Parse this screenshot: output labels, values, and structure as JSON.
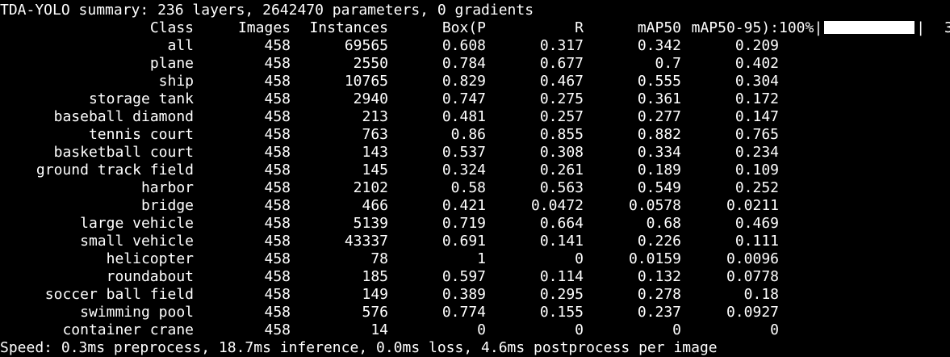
{
  "summary": "TDA-YOLO summary: 236 layers, 2642470 parameters, 0 gradients",
  "header": {
    "class": "Class",
    "images": "Images",
    "instances": "Instances",
    "p": "Box(P",
    "r": "R",
    "map50": "mAP50",
    "map50_95": "mAP50-95):",
    "progress": "100%",
    "progress_fraction": 1.0,
    "bar_left": "|",
    "bar_right": "|",
    "edge": "3"
  },
  "rows": [
    {
      "class": "all",
      "images": "458",
      "instances": "69565",
      "p": "0.608",
      "r": "0.317",
      "map50": "0.342",
      "map50_95": "0.209"
    },
    {
      "class": "plane",
      "images": "458",
      "instances": "2550",
      "p": "0.784",
      "r": "0.677",
      "map50": "0.7",
      "map50_95": "0.402"
    },
    {
      "class": "ship",
      "images": "458",
      "instances": "10765",
      "p": "0.829",
      "r": "0.467",
      "map50": "0.555",
      "map50_95": "0.304"
    },
    {
      "class": "storage tank",
      "images": "458",
      "instances": "2940",
      "p": "0.747",
      "r": "0.275",
      "map50": "0.361",
      "map50_95": "0.172"
    },
    {
      "class": "baseball diamond",
      "images": "458",
      "instances": "213",
      "p": "0.481",
      "r": "0.257",
      "map50": "0.277",
      "map50_95": "0.147"
    },
    {
      "class": "tennis court",
      "images": "458",
      "instances": "763",
      "p": "0.86",
      "r": "0.855",
      "map50": "0.882",
      "map50_95": "0.765"
    },
    {
      "class": "basketball court",
      "images": "458",
      "instances": "143",
      "p": "0.537",
      "r": "0.308",
      "map50": "0.334",
      "map50_95": "0.234"
    },
    {
      "class": "ground track field",
      "images": "458",
      "instances": "145",
      "p": "0.324",
      "r": "0.261",
      "map50": "0.189",
      "map50_95": "0.109"
    },
    {
      "class": "harbor",
      "images": "458",
      "instances": "2102",
      "p": "0.58",
      "r": "0.563",
      "map50": "0.549",
      "map50_95": "0.252"
    },
    {
      "class": "bridge",
      "images": "458",
      "instances": "466",
      "p": "0.421",
      "r": "0.0472",
      "map50": "0.0578",
      "map50_95": "0.0211"
    },
    {
      "class": "large vehicle",
      "images": "458",
      "instances": "5139",
      "p": "0.719",
      "r": "0.664",
      "map50": "0.68",
      "map50_95": "0.469"
    },
    {
      "class": "small vehicle",
      "images": "458",
      "instances": "43337",
      "p": "0.691",
      "r": "0.141",
      "map50": "0.226",
      "map50_95": "0.111"
    },
    {
      "class": "helicopter",
      "images": "458",
      "instances": "78",
      "p": "1",
      "r": "0",
      "map50": "0.0159",
      "map50_95": "0.0096"
    },
    {
      "class": "roundabout",
      "images": "458",
      "instances": "185",
      "p": "0.597",
      "r": "0.114",
      "map50": "0.132",
      "map50_95": "0.0778"
    },
    {
      "class": "soccer ball field",
      "images": "458",
      "instances": "149",
      "p": "0.389",
      "r": "0.295",
      "map50": "0.278",
      "map50_95": "0.18"
    },
    {
      "class": "swimming pool",
      "images": "458",
      "instances": "576",
      "p": "0.774",
      "r": "0.155",
      "map50": "0.237",
      "map50_95": "0.0927"
    },
    {
      "class": "container crane",
      "images": "458",
      "instances": "14",
      "p": "0",
      "r": "0",
      "map50": "0",
      "map50_95": "0"
    }
  ],
  "speed": "Speed: 0.3ms preprocess, 18.7ms inference, 0.0ms loss, 4.6ms postprocess per image",
  "colors": {
    "background": "#000000",
    "text": "#ffffff"
  }
}
